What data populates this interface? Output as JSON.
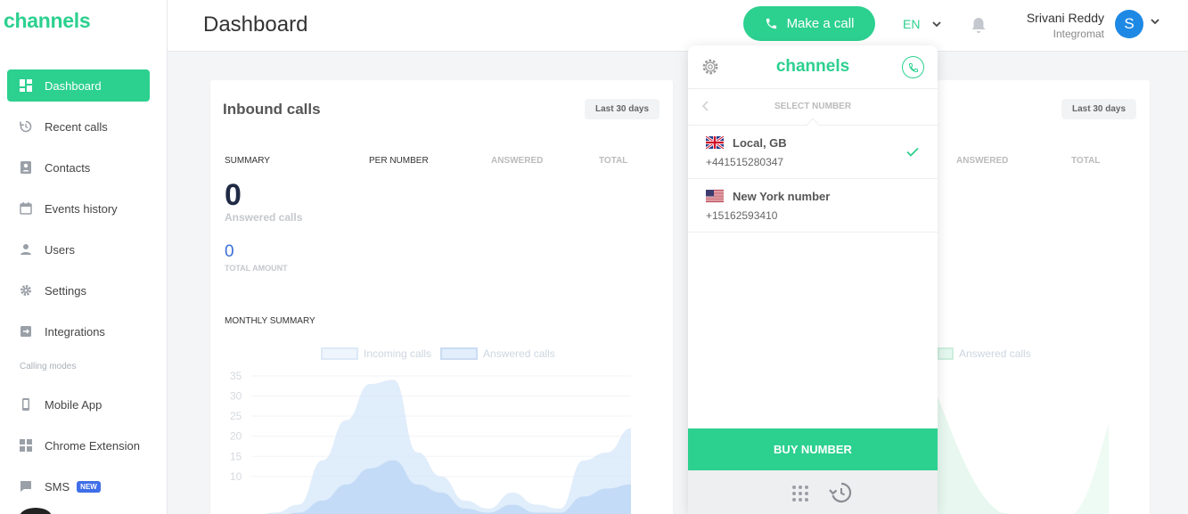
{
  "app": {
    "logo": "channels"
  },
  "sidebar": {
    "items": [
      {
        "label": "Dashboard",
        "icon": "dashboard-icon",
        "active": true
      },
      {
        "label": "Recent calls",
        "icon": "history-icon"
      },
      {
        "label": "Contacts",
        "icon": "contacts-icon"
      },
      {
        "label": "Events history",
        "icon": "calendar-icon"
      },
      {
        "label": "Users",
        "icon": "user-icon"
      },
      {
        "label": "Settings",
        "icon": "gear-icon"
      },
      {
        "label": "Integrations",
        "icon": "integrations-icon"
      }
    ],
    "section_label": "Calling modes",
    "modes": [
      {
        "label": "Mobile App",
        "icon": "mobile-icon"
      },
      {
        "label": "Chrome Extension",
        "icon": "puzzle-icon"
      },
      {
        "label": "SMS",
        "icon": "sms-icon",
        "badge": "NEW"
      }
    ]
  },
  "header": {
    "title": "Dashboard",
    "make_call_label": "Make a call",
    "language": "EN",
    "user_name": "Srivani Reddy",
    "user_org": "Integromat",
    "avatar_initial": "S"
  },
  "inbound_card": {
    "title": "Inbound calls",
    "period": "Last 30 days",
    "columns": [
      "SUMMARY",
      "PER NUMBER",
      "ANSWERED",
      "TOTAL"
    ],
    "answered_value": "0",
    "answered_label": "Answered calls",
    "total_value": "0",
    "total_label": "TOTAL AMOUNT",
    "monthly_label": "MONTHLY SUMMARY",
    "legend": [
      "Incoming calls",
      "Answered calls"
    ]
  },
  "second_card": {
    "period": "Last 30 days",
    "columns": [
      "ANSWERED",
      "TOTAL"
    ],
    "legend": [
      "Answered calls"
    ]
  },
  "chart_data": {
    "type": "area",
    "series": [
      {
        "name": "Incoming calls",
        "values": [
          0,
          1,
          3,
          14,
          24,
          33,
          34,
          16,
          10,
          4,
          2,
          6,
          3,
          2,
          14,
          16,
          22
        ]
      },
      {
        "name": "Answered calls",
        "values": [
          0,
          0,
          1,
          4,
          8,
          12,
          14,
          8,
          6,
          2,
          1,
          3,
          1,
          1,
          5,
          7,
          8
        ]
      }
    ],
    "yticks": [
      "35",
      "30",
      "25",
      "20",
      "15",
      "10"
    ],
    "ylim": [
      0,
      37
    ],
    "colors": {
      "incoming": "#d6e7fa",
      "answered": "#bcd6f5"
    }
  },
  "popup": {
    "logo": "channels",
    "select_label": "SELECT NUMBER",
    "numbers": [
      {
        "name": "Local, GB",
        "phone": "+441515280347",
        "flag": "gb",
        "selected": true
      },
      {
        "name": "New York number",
        "phone": "+15162593410",
        "flag": "us",
        "selected": false
      }
    ],
    "buy_label": "BUY NUMBER"
  },
  "colors": {
    "brand": "#2cd08f",
    "avatar": "#1e88e5",
    "accent_blue": "#3b6fd8"
  }
}
